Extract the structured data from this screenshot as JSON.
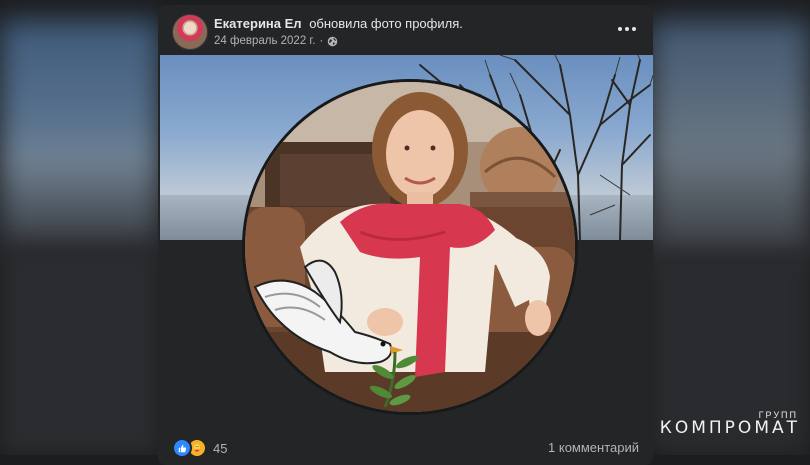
{
  "post": {
    "author": "Екатерина Ел",
    "action": "обновила фото профиля.",
    "date": "24 февраль 2022 г.",
    "separator": "·",
    "privacy_icon": "globe-icon",
    "more_icon": "more-horizontal-icon"
  },
  "footer": {
    "reaction_icons": [
      "like-reaction-icon",
      "care-reaction-icon"
    ],
    "reaction_count": "45",
    "comments": "1 комментарий"
  },
  "watermark": {
    "top": "ГРУПП",
    "main": "КОМПРОМАТ"
  },
  "colors": {
    "card_bg": "#242526",
    "text_primary": "#e4e6eb",
    "text_secondary": "#b0b3b8",
    "like_blue": "#2d88ff",
    "scarf_red": "#d8384f"
  }
}
